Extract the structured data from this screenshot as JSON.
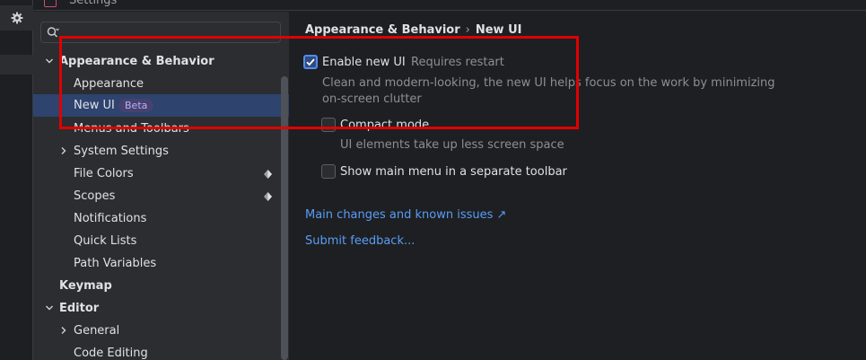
{
  "window": {
    "title": "Settings"
  },
  "search": {
    "placeholder": "",
    "value": ""
  },
  "tree": {
    "items": [
      {
        "label": "Appearance & Behavior"
      },
      {
        "label": "Appearance"
      },
      {
        "label": "New UI",
        "badge": "Beta"
      },
      {
        "label": "Menus and Toolbars"
      },
      {
        "label": "System Settings"
      },
      {
        "label": "File Colors"
      },
      {
        "label": "Scopes"
      },
      {
        "label": "Notifications"
      },
      {
        "label": "Quick Lists"
      },
      {
        "label": "Path Variables"
      },
      {
        "label": "Keymap"
      },
      {
        "label": "Editor"
      },
      {
        "label": "General"
      },
      {
        "label": "Code Editing"
      }
    ]
  },
  "breadcrumb": {
    "parent": "Appearance & Behavior",
    "separator": "›",
    "current": "New UI"
  },
  "options": {
    "enable_new_ui": {
      "label": "Enable new UI",
      "hint": "Requires restart",
      "checked": true,
      "description": [
        "Clean and modern-looking, the new UI helps focus on the work by minimizing",
        "on-screen clutter"
      ]
    },
    "compact_mode": {
      "label": "Compact mode",
      "checked": false,
      "description": "UI elements take up less screen space"
    },
    "separate_toolbar": {
      "label": "Show main menu in a separate toolbar",
      "checked": false
    }
  },
  "links": {
    "main_changes": "Main changes and known issues ↗",
    "feedback": "Submit feedback..."
  },
  "colors": {
    "accent": "#548af7",
    "selection": "#2e436e",
    "annotation": "#e00000",
    "link": "#589df6"
  }
}
